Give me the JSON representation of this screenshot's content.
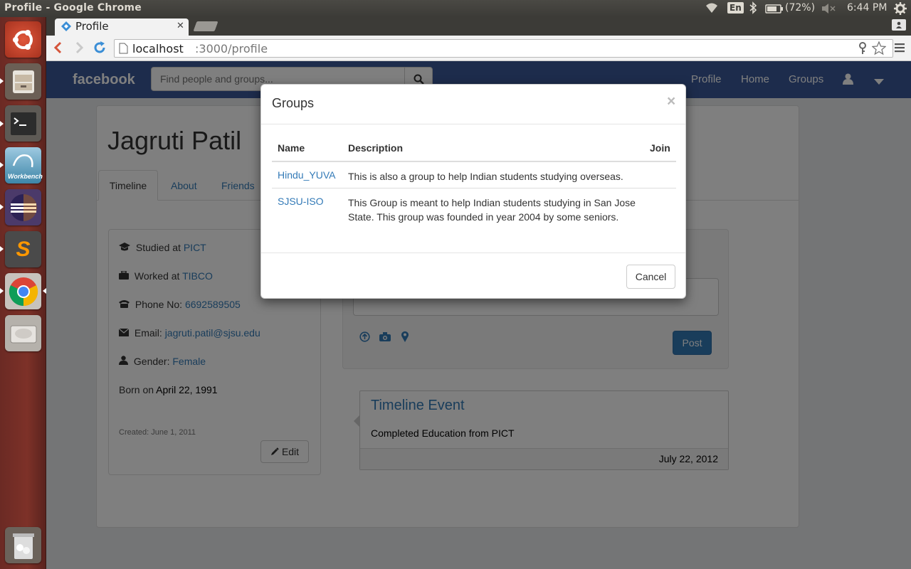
{
  "system": {
    "window_title": "Profile - Google Chrome",
    "keyboard_layout": "En",
    "battery": "(72%)",
    "clock": "6:44 PM"
  },
  "launcher": {
    "apps": [
      "ubuntu-dash-icon",
      "files-icon",
      "terminal-icon",
      "mysql-workbench-icon",
      "eclipse-icon",
      "sublime-text-icon",
      "chrome-icon",
      "disks-icon",
      "trash-icon"
    ],
    "workbench_label": "Workbench",
    "sublime_letter": "S"
  },
  "browser": {
    "tab_title": "Profile",
    "url_host": "localhost",
    "url_path": ":3000/profile"
  },
  "navbar": {
    "brand": "facebook",
    "search_placeholder": "Find people and groups...",
    "links": [
      "Profile",
      "Home",
      "Groups"
    ]
  },
  "profile": {
    "name": "Jagruti Patil",
    "tabs": [
      "Timeline",
      "About",
      "Friends"
    ],
    "info": {
      "studied_label": "Studied at",
      "studied_value": "PICT",
      "worked_label": "Worked at",
      "worked_value": "TIBCO",
      "phone_label": "Phone No:",
      "phone_value": "6692589505",
      "email_label": "Email:",
      "email_value": "jagruti.patil@sjsu.edu",
      "gender_label": "Gender:",
      "gender_value": "Female",
      "born_label": "Born on",
      "born_value": "April 22, 1991",
      "created": "Created: June 1, 2011",
      "edit_label": "Edit"
    },
    "composer": {
      "post_label": "Post"
    },
    "timeline_event": {
      "title": "Timeline Event",
      "text": "Completed Education from PICT",
      "date": "July 22, 2012"
    }
  },
  "modal": {
    "title": "Groups",
    "close": "×",
    "columns": [
      "Name",
      "Description",
      "Join"
    ],
    "rows": [
      {
        "name": "Hindu_YUVA",
        "description": "This is also a group to help Indian students studying overseas."
      },
      {
        "name": "SJSU-ISO",
        "description": "This Group is meant to help Indian students studying in San Jose State. This group was founded in year 2004 by some seniors."
      }
    ],
    "cancel_label": "Cancel"
  },
  "colors": {
    "facebook_blue": "#3b5998",
    "link": "#337ab7",
    "primary_button": "#337ab7",
    "launcher": "#7d3128"
  }
}
